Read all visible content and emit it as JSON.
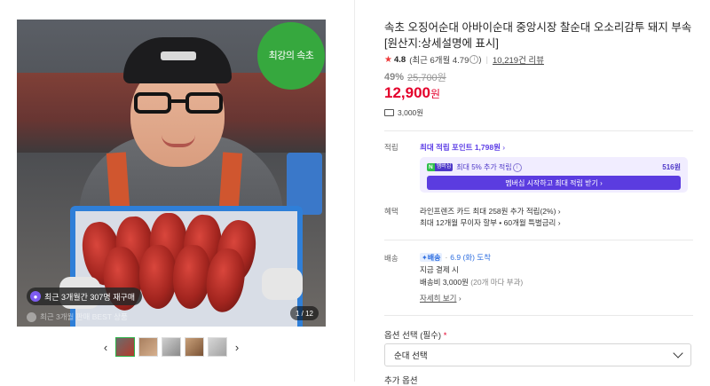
{
  "gallery": {
    "brand_logo_text": "최강의 속초",
    "badge_repurchase": "최근 3개월간 307명 재구매",
    "badge_best": "최근 3개월 판매 BEST 상품",
    "counter": "1 / 12",
    "prev_icon": "chevron-left-icon",
    "next_icon": "chevron-right-icon",
    "thumbnail_count": 5
  },
  "product": {
    "title": "속초 오징어순대 아바이순대 중앙시장 찰순대 오소리감투 돼지 부속 [원산지:상세설명에 표시]",
    "rating": "4.8",
    "rating_recent": "(최근 6개월 4.79",
    "rating_recent_close": ")",
    "review_count": "10,219건 리뷰",
    "discount": "49%",
    "original_price": "25,700원",
    "price": "12,900",
    "price_unit": "원",
    "shipping_fee": "3,000원"
  },
  "points": {
    "label": "적립",
    "max_point": "최대 적립 포인트 1,798원",
    "np_brand": "N",
    "np_sub": "멤버십",
    "np_text": "최대 5% 추가 적립",
    "np_amount": "516원",
    "np_button": "멤버십 시작하고 최대 적립 받기"
  },
  "benefits": {
    "label": "혜택",
    "line1": "라인프렌즈 카드 최대 258원 추가 적립(2%)",
    "line2": "최대 12개월 무이자 할부 • 60개월 특별금리"
  },
  "delivery": {
    "label": "배송",
    "badge": "배송",
    "date": "6.9 (화) 도착",
    "line1": "지금 결제 시",
    "fee": "배송비 3,000원",
    "fee_note": "(20개 마다 부과)",
    "more": "자세히 보기"
  },
  "options": {
    "label": "옵션 선택 (필수)",
    "required_mark": "*",
    "select_value": "순대 선택",
    "extra_label": "추가 옵션"
  },
  "colors": {
    "price": "#e4002b",
    "accent": "#5b3ce0",
    "brand_green": "#2fbf4a"
  }
}
